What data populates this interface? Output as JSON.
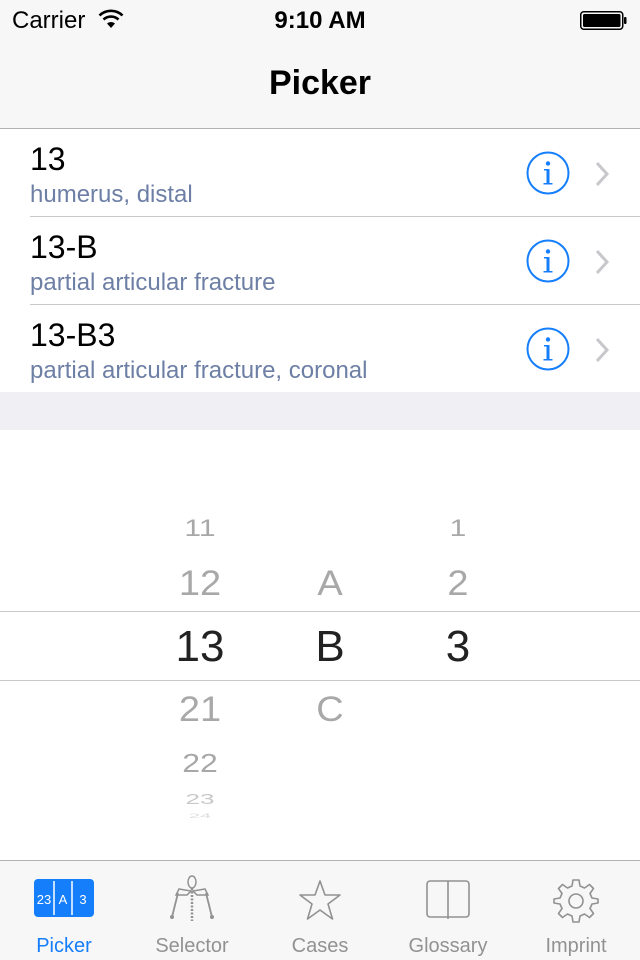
{
  "status_bar": {
    "carrier": "Carrier",
    "time": "9:10 AM",
    "wifi_icon": "wifi-icon",
    "battery_icon": "battery-full-icon"
  },
  "nav": {
    "title": "Picker"
  },
  "colors": {
    "accent": "#157efb",
    "subtitle": "#6d7fa5",
    "chevron": "#c7c7cc",
    "tab_inactive": "#929292",
    "group_background": "#efeff4"
  },
  "rows": [
    {
      "title": "13",
      "subtitle": "humerus, distal",
      "info_icon": "info-circle-icon",
      "chevron_icon": "chevron-right-icon"
    },
    {
      "title": "13-B",
      "subtitle": "partial articular fracture",
      "info_icon": "info-circle-icon",
      "chevron_icon": "chevron-right-icon"
    },
    {
      "title": "13-B3",
      "subtitle": "partial articular fracture, coronal",
      "info_icon": "info-circle-icon",
      "chevron_icon": "chevron-right-icon"
    }
  ],
  "picker": {
    "columns": [
      {
        "name": "bone-segment",
        "visible": [
          "11",
          "12",
          "13",
          "21",
          "22",
          "23",
          "24"
        ],
        "selected": "13"
      },
      {
        "name": "type",
        "visible": [
          "A",
          "B",
          "C"
        ],
        "selected": "B"
      },
      {
        "name": "group",
        "visible": [
          "1",
          "2",
          "3"
        ],
        "selected": "3"
      }
    ]
  },
  "tabbar": {
    "active": "Picker",
    "tabs": [
      {
        "label": "Picker",
        "icon": "picker-code-icon",
        "icon_text": [
          "23",
          "A",
          "3"
        ]
      },
      {
        "label": "Selector",
        "icon": "skeleton-selector-icon"
      },
      {
        "label": "Cases",
        "icon": "star-icon"
      },
      {
        "label": "Glossary",
        "icon": "book-icon"
      },
      {
        "label": "Imprint",
        "icon": "gear-icon"
      }
    ]
  }
}
